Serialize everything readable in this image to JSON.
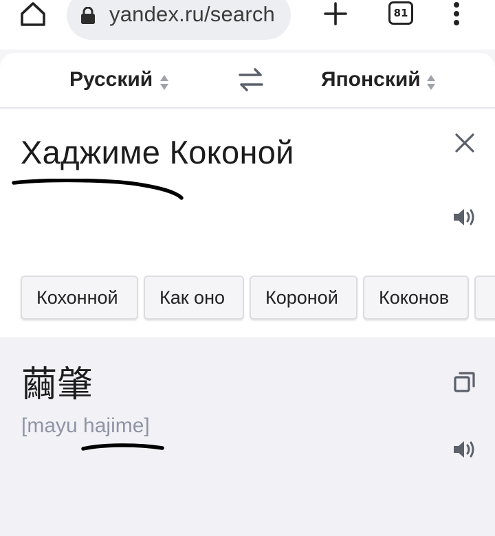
{
  "browser": {
    "url": "yandex.ru/search",
    "tab_count": "81",
    "icons": {
      "home": "home-icon",
      "lock": "lock-icon",
      "new_tab": "plus-icon",
      "tabs": "tabs-counter-icon",
      "menu": "more-vertical-icon"
    }
  },
  "translator": {
    "source_language": "Русский",
    "target_language": "Японский",
    "source_text": "Хаджиме Коконой",
    "suggestions": [
      {
        "label": "Кохонной"
      },
      {
        "label": "Как оно"
      },
      {
        "label": "Короной"
      },
      {
        "label": "Коконов"
      },
      {
        "label": ""
      }
    ],
    "translation": "繭肇",
    "transliteration": "[mayu hajime]"
  },
  "colors": {
    "background": "#f5f5f7",
    "card": "#ffffff",
    "result_bg": "#f2f2f6",
    "text": "#1f1f1f",
    "muted": "#8f95a5",
    "icon": "#545a66"
  }
}
